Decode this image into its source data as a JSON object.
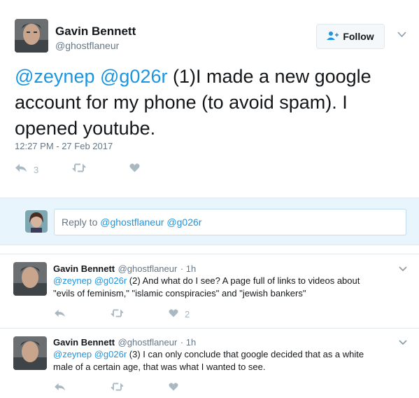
{
  "main_tweet": {
    "author_name": "Gavin Bennett",
    "author_handle": "@ghostflaneur",
    "follow_label": "Follow",
    "mention1": "@zeynep",
    "mention2": "@g026r",
    "text_line1_rest": "(1)I made a new google",
    "text_line2": "account for my phone (to avoid spam). I",
    "text_line3": "opened youtube.",
    "timestamp": "12:27 PM - 27 Feb 2017",
    "reply_count": "3"
  },
  "reply_box": {
    "prefix": "Reply to ",
    "mentions": "@ghostflaneur @g026r"
  },
  "replies": [
    {
      "author_name": "Gavin Bennett",
      "author_handle": "@ghostflaneur",
      "time": "· 1h",
      "mentions": "@zeynep @g026r",
      "text_line1": " (2) And what do I see? A page full of links to videos about",
      "text_line2": "\"evils of feminism,\" \"islamic conspiracies\" and \"jewish bankers\"",
      "like_count": "2"
    },
    {
      "author_name": "Gavin Bennett",
      "author_handle": "@ghostflaneur",
      "time": "· 1h",
      "mentions": "@zeynep @g026r",
      "text_line1": " (3) I can only conclude that google decided that as a white",
      "text_line2": "male of a certain age, that was what I wanted to see."
    }
  ],
  "colors": {
    "accent": "#1b95e0",
    "muted": "#657786",
    "icon": "#aab8c2",
    "reply_bg": "#e8f5fd"
  }
}
